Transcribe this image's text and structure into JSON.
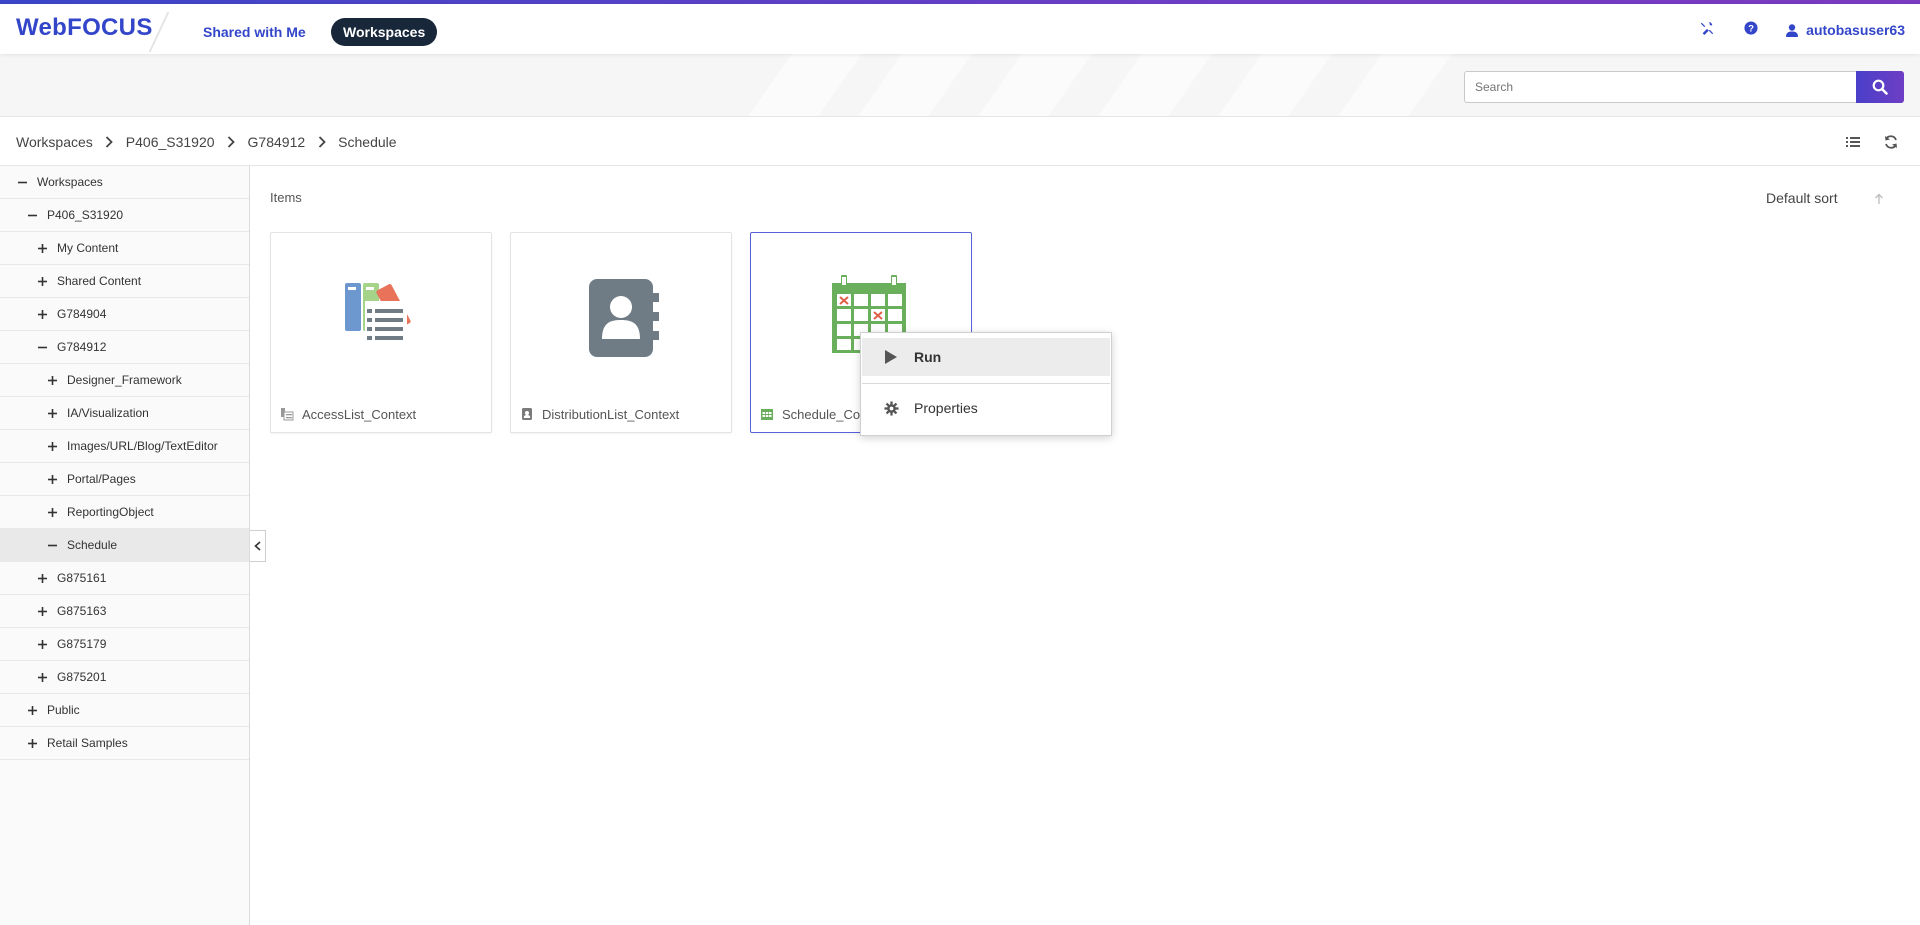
{
  "header": {
    "logo": "WebFOCUS",
    "nav": {
      "shared_with_me": "Shared with Me",
      "workspaces": "Workspaces"
    },
    "icons": [
      "tools-icon",
      "help-icon",
      "user-icon"
    ],
    "username": "autobasuser63",
    "accent_color": "#3346c9"
  },
  "search": {
    "placeholder": "Search",
    "value": ""
  },
  "breadcrumb": {
    "items": [
      "Workspaces",
      "P406_S31920",
      "G784912",
      "Schedule"
    ]
  },
  "tree": {
    "items": [
      {
        "label": "Workspaces",
        "state": "expanded"
      },
      {
        "label": "P406_S31920",
        "state": "expanded"
      },
      {
        "label": "My Content",
        "state": "collapsed"
      },
      {
        "label": "Shared Content",
        "state": "collapsed"
      },
      {
        "label": "G784904",
        "state": "collapsed"
      },
      {
        "label": "G784912",
        "state": "expanded"
      },
      {
        "label": "Designer_Framework",
        "state": "collapsed"
      },
      {
        "label": "IA/Visualization",
        "state": "collapsed"
      },
      {
        "label": "Images/URL/Blog/TextEditor",
        "state": "collapsed"
      },
      {
        "label": "Portal/Pages",
        "state": "collapsed"
      },
      {
        "label": "ReportingObject",
        "state": "collapsed"
      },
      {
        "label": "Schedule",
        "state": "expanded",
        "selected": true
      },
      {
        "label": "G875161",
        "state": "collapsed"
      },
      {
        "label": "G875163",
        "state": "collapsed"
      },
      {
        "label": "G875179",
        "state": "collapsed"
      },
      {
        "label": "G875201",
        "state": "collapsed"
      },
      {
        "label": "Public",
        "state": "collapsed"
      },
      {
        "label": "Retail Samples",
        "state": "collapsed"
      }
    ]
  },
  "main": {
    "heading": "Items",
    "sort_label": "Default sort",
    "cards": [
      {
        "label": "AccessList_Context",
        "icon": "access-list-icon"
      },
      {
        "label": "DistributionList_Context",
        "icon": "distribution-list-icon"
      },
      {
        "label": "Schedule_Co",
        "icon": "schedule-icon",
        "selected": true
      }
    ]
  },
  "context_menu": {
    "items": [
      {
        "label": "Run",
        "icon": "play-icon"
      },
      {
        "label": "Properties",
        "icon": "gear-icon"
      }
    ]
  }
}
